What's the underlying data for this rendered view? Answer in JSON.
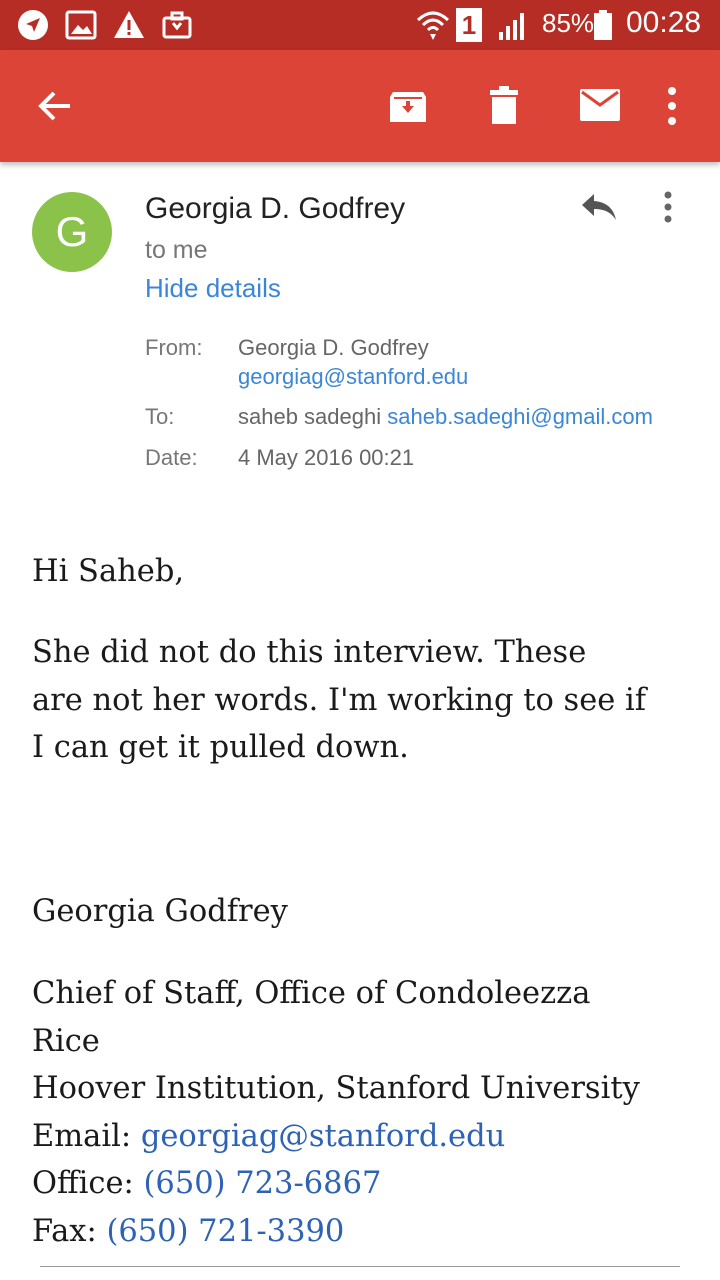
{
  "status_bar": {
    "battery": "85%",
    "sim": "1",
    "time": "00:28",
    "icons": [
      "navigation-icon",
      "gallery-icon",
      "warning-icon",
      "briefcase-icon",
      "wifi-icon",
      "signal-icon",
      "battery-icon"
    ]
  },
  "app_bar": {
    "color": "#db4437",
    "actions": [
      "back-icon",
      "archive-icon",
      "delete-icon",
      "mark-unread-icon",
      "overflow-menu-icon"
    ]
  },
  "message": {
    "avatar_letter": "G",
    "avatar_color": "#8bc34a",
    "sender": "Georgia D. Godfrey",
    "recipient_summary": "to me",
    "hide_details": "Hide details",
    "details": {
      "from_label": "From:",
      "from_name": "Georgia D. Godfrey",
      "from_email": "georgiag@stanford.edu",
      "to_label": "To:",
      "to_name": "saheb sadeghi",
      "to_email": "saheb.sadeghi@gmail.com",
      "date_label": "Date:",
      "date_value": "4 May 2016 00:21"
    },
    "body": {
      "greeting": "Hi Saheb,",
      "paragraph_lines": [
        "She did not do this interview.  These",
        "are not her words.  I'm working to see if",
        "I can get it pulled down."
      ]
    },
    "signature": {
      "name": "Georgia Godfrey",
      "title_line1": "Chief of Staff, Office of Condoleezza",
      "title_line2": "Rice",
      "institution": "Hoover Institution, Stanford University",
      "email_label": "Email: ",
      "email": "georgiag@stanford.edu",
      "office_label": "Office: ",
      "office_phone": "(650) 723-6867",
      "fax_label": "Fax: ",
      "fax_phone": "(650) 721-3390"
    }
  }
}
